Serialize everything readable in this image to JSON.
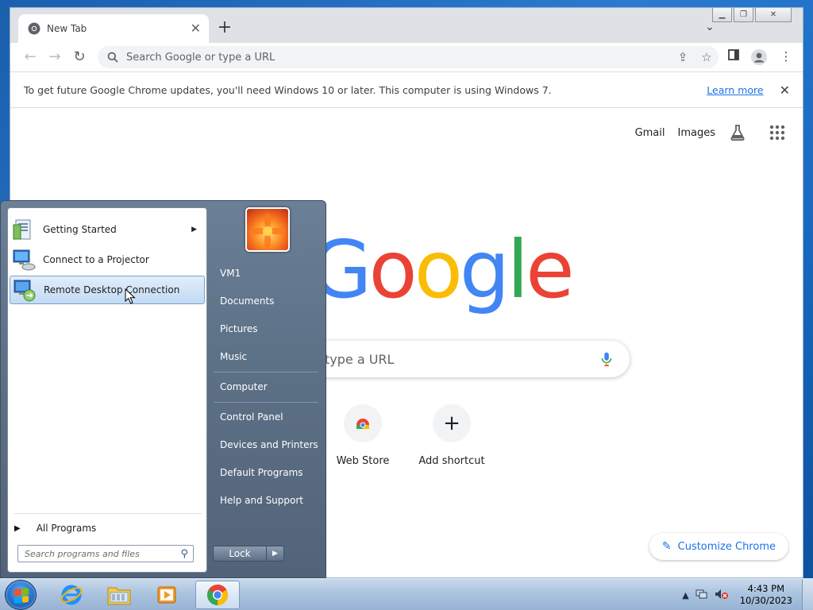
{
  "browser": {
    "tab": {
      "title": "New Tab"
    },
    "omnibox": {
      "placeholder": "Search Google or type a URL"
    },
    "infobar": {
      "message": "To get future Google Chrome updates, you'll need Windows 10 or later. This computer is using Windows 7.",
      "link": "Learn more"
    },
    "ntp": {
      "links": [
        "Gmail",
        "Images"
      ],
      "logo_letters": [
        "G",
        "o",
        "o",
        "g",
        "l",
        "e"
      ],
      "search_placeholder_visible": "type a URL",
      "shortcuts": [
        {
          "label": "Web Store"
        },
        {
          "label": "Add shortcut",
          "glyph": "+"
        }
      ],
      "customize_label": "Customize Chrome"
    }
  },
  "colors": {
    "google_blue": "#4285F4",
    "google_red": "#EA4335",
    "google_yellow": "#FBBC05",
    "google_green": "#34A853",
    "link_blue": "#1a73e8"
  },
  "start_menu": {
    "programs": [
      {
        "label": "Getting Started",
        "has_submenu": true
      },
      {
        "label": "Connect to a Projector",
        "has_submenu": false
      },
      {
        "label": "Remote Desktop Connection",
        "has_submenu": false
      }
    ],
    "all_programs": "All Programs",
    "search_placeholder": "Search programs and files",
    "right_items": [
      "VM1",
      "Documents",
      "Pictures",
      "Music",
      "Computer",
      "Control Panel",
      "Devices and Printers",
      "Default Programs",
      "Help and Support"
    ],
    "lock_label": "Lock"
  },
  "taskbar": {
    "apps": [
      "internet-explorer-icon",
      "windows-explorer-icon",
      "media-player-icon",
      "chrome-icon"
    ],
    "clock": {
      "time": "4:43 PM",
      "date": "10/30/2023"
    }
  }
}
